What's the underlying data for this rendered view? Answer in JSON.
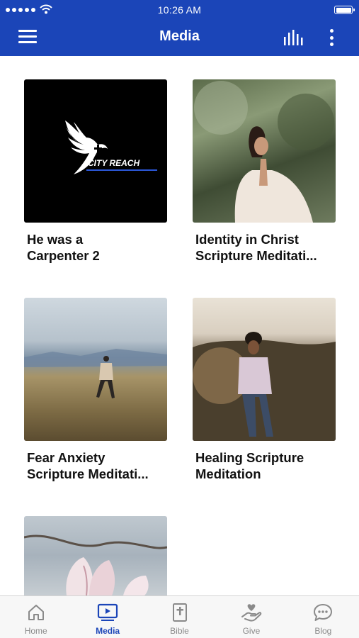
{
  "status_bar": {
    "time": "10:26 AM"
  },
  "header": {
    "title": "Media"
  },
  "cards": [
    {
      "line1": "He was a",
      "line2": "Carpenter 2",
      "logo_text": "CITY REACH"
    },
    {
      "line1": "Identity in Christ",
      "line2": "Scripture Meditati..."
    },
    {
      "line1": "Fear Anxiety",
      "line2": "Scripture Meditati..."
    },
    {
      "line1": "Healing Scripture",
      "line2": "Meditation"
    },
    {
      "line1": "",
      "line2": ""
    }
  ],
  "tabbar": {
    "active": "Media",
    "items": [
      {
        "label": "Home",
        "icon": "home-icon"
      },
      {
        "label": "Media",
        "icon": "media-play-icon"
      },
      {
        "label": "Bible",
        "icon": "bible-icon"
      },
      {
        "label": "Give",
        "icon": "give-hand-heart-icon"
      },
      {
        "label": "Blog",
        "icon": "chat-bubble-icon"
      }
    ]
  },
  "colors": {
    "brand": "#1b45b8",
    "inactive": "#8a8a8a"
  }
}
